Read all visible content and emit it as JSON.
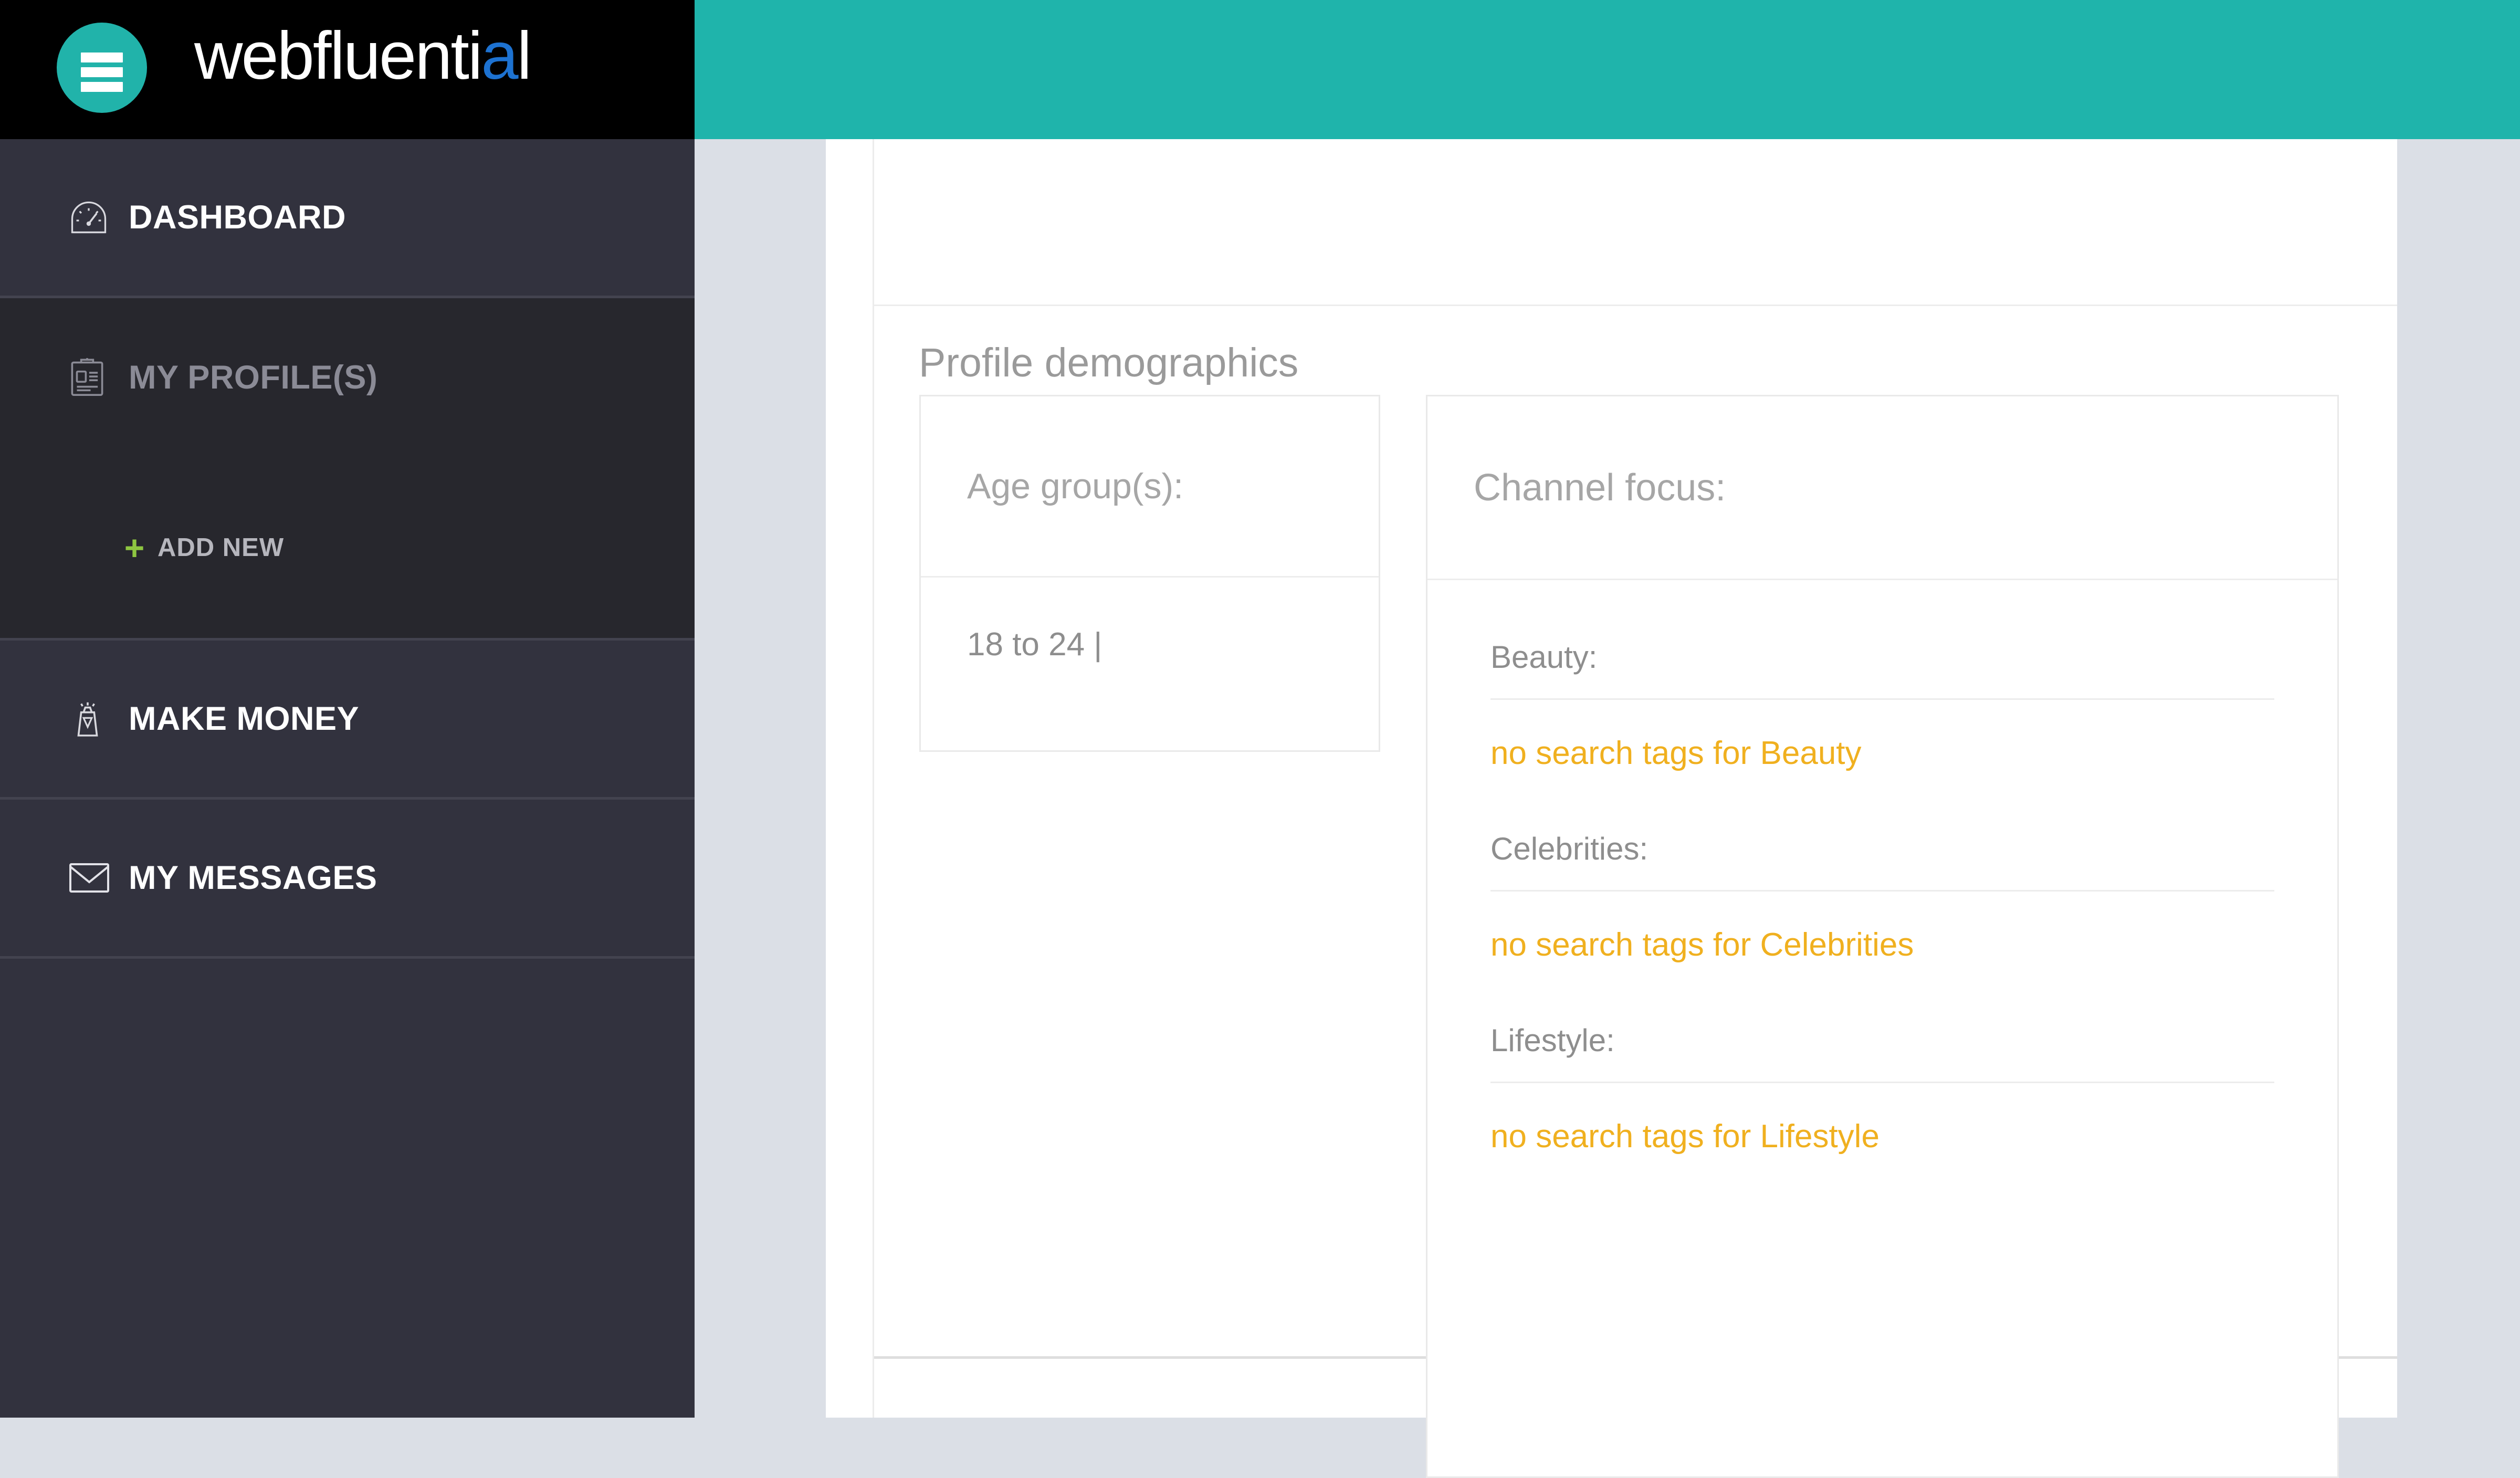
{
  "brand": {
    "name_main": "webfluenti",
    "name_accent": "a",
    "name_tail": "l",
    "menu_icon": "hamburger-icon",
    "teal": "#1fb4ab"
  },
  "sidebar": {
    "items": [
      {
        "id": "dashboard",
        "label": "DASHBOARD",
        "icon": "speedometer-icon",
        "active": true
      },
      {
        "id": "my-profiles",
        "label": "MY PROFILE(S)",
        "icon": "id-card-icon",
        "active": false,
        "submenu": [
          {
            "id": "add-new",
            "label": "ADD NEW",
            "icon": "plus-icon"
          }
        ]
      },
      {
        "id": "make-money",
        "label": "MAKE MONEY",
        "icon": "money-bag-icon",
        "active": false
      },
      {
        "id": "my-messages",
        "label": "MY MESSAGES",
        "icon": "envelope-icon",
        "active": false
      }
    ]
  },
  "main": {
    "page_title": "Profile demographics",
    "age_card": {
      "header": "Age group(s):",
      "value": "18 to 24 |"
    },
    "channel_focus_card": {
      "header": "Channel focus:",
      "groups": [
        {
          "label": "Beauty:",
          "value": "no search tags for Beauty"
        },
        {
          "label": "Celebrities:",
          "value": "no search tags for Celebrities"
        },
        {
          "label": "Lifestyle:",
          "value": "no search tags for Lifestyle"
        }
      ]
    }
  },
  "colors": {
    "accent_teal": "#1fb4ab",
    "warning_orange": "#f0b01f",
    "sidebar_dark": "#32323e",
    "sidebar_submenu": "#27272d",
    "plus_green": "#8ec641",
    "page_bg": "#dbdfe6"
  }
}
